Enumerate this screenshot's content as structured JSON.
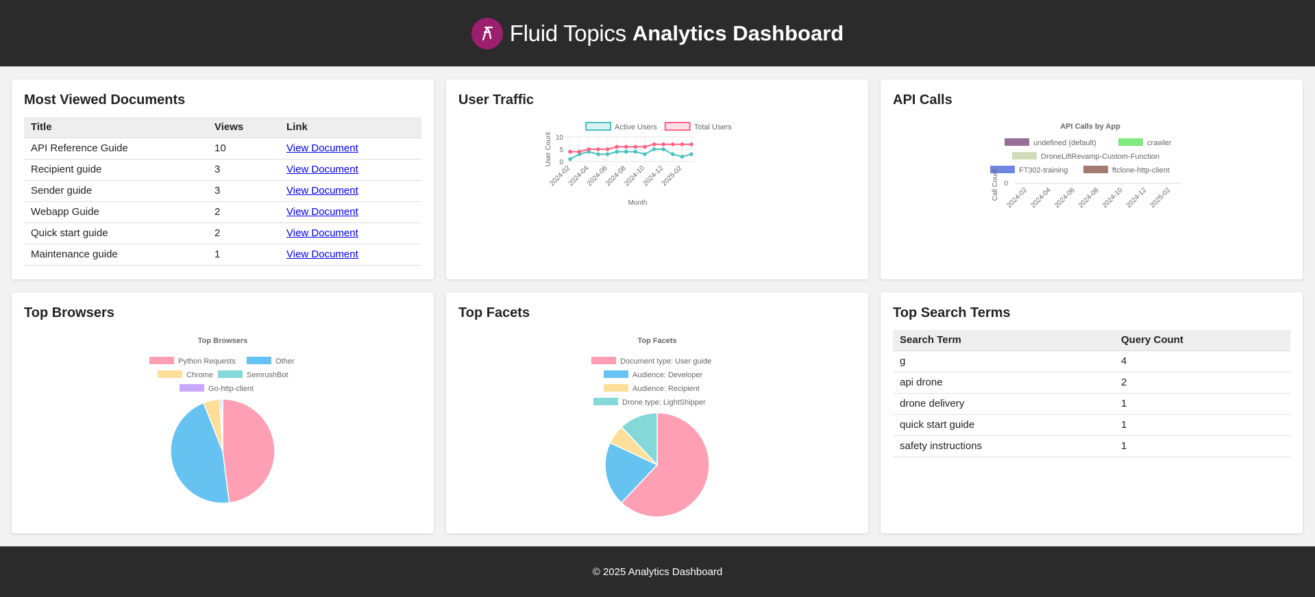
{
  "header": {
    "brand": "Fluid Topics",
    "title": "Analytics Dashboard"
  },
  "most_viewed": {
    "title": "Most Viewed Documents",
    "columns": [
      "Title",
      "Views",
      "Link"
    ],
    "rows": [
      {
        "title": "API Reference Guide",
        "views": "10",
        "link": "View Document"
      },
      {
        "title": "Recipient guide",
        "views": "3",
        "link": "View Document"
      },
      {
        "title": "Sender guide",
        "views": "3",
        "link": "View Document"
      },
      {
        "title": "Webapp Guide",
        "views": "2",
        "link": "View Document"
      },
      {
        "title": "Quick start guide",
        "views": "2",
        "link": "View Document"
      },
      {
        "title": "Maintenance guide",
        "views": "1",
        "link": "View Document"
      }
    ]
  },
  "user_traffic": {
    "title": "User Traffic"
  },
  "api_calls": {
    "title": "API Calls"
  },
  "top_browsers": {
    "title": "Top Browsers"
  },
  "top_facets": {
    "title": "Top Facets"
  },
  "top_search_terms": {
    "title": "Top Search Terms",
    "columns": [
      "Search Term",
      "Query Count"
    ],
    "rows": [
      {
        "term": "g",
        "count": "4"
      },
      {
        "term": "api drone",
        "count": "2"
      },
      {
        "term": "drone delivery",
        "count": "1"
      },
      {
        "term": "quick start guide",
        "count": "1"
      },
      {
        "term": "safety instructions",
        "count": "1"
      }
    ]
  },
  "footer": {
    "text": "© 2025 Analytics Dashboard"
  },
  "chart_data": [
    {
      "id": "user-traffic",
      "type": "line",
      "title": "",
      "xlabel": "Month",
      "ylabel": "User Count",
      "x": [
        "2024-02",
        "2024-03",
        "2024-04",
        "2024-05",
        "2024-06",
        "2024-07",
        "2024-08",
        "2024-09",
        "2024-10",
        "2024-11",
        "2024-12",
        "2025-01",
        "2025-02",
        "2025-03"
      ],
      "x_tick_labels": [
        "2024-02",
        "2024-04",
        "2024-06",
        "2024-08",
        "2024-10",
        "2024-12",
        "2025-02"
      ],
      "y_ticks": [
        0,
        5,
        10
      ],
      "ylim": [
        0,
        10
      ],
      "legend": "top",
      "series": [
        {
          "name": "Active Users",
          "color": "#4bc0c0",
          "values": [
            1,
            3,
            4,
            3,
            3,
            4,
            4,
            4,
            3,
            5,
            5,
            3,
            2,
            3
          ]
        },
        {
          "name": "Total Users",
          "color": "#ff6384",
          "values": [
            4,
            4,
            5,
            5,
            5,
            6,
            6,
            6,
            6,
            7,
            7,
            7,
            7,
            7
          ]
        }
      ]
    },
    {
      "id": "api-calls",
      "type": "bar",
      "title": "API Calls by App",
      "xlabel": "",
      "ylabel": "Call Count",
      "x_tick_labels": [
        "2024-02",
        "2024-04",
        "2024-06",
        "2024-08",
        "2024-10",
        "2024-12",
        "2025-02"
      ],
      "y_ticks": [
        0
      ],
      "legend": "top",
      "series": [
        {
          "name": "undefined (default)",
          "color": "#9a6f97"
        },
        {
          "name": "crawler",
          "color": "#7fe87f"
        },
        {
          "name": "DroneLiftRevamp-Custom-Function",
          "color": "#d2dcbb"
        },
        {
          "name": "FT302-training",
          "color": "#6f86e0"
        },
        {
          "name": "ftclone-http-client",
          "color": "#a37b73"
        }
      ]
    },
    {
      "id": "top-browsers",
      "type": "pie",
      "title": "Top Browsers",
      "legend": "top",
      "series": [
        {
          "name": "Top Browsers",
          "labels": [
            "Python Requests",
            "Other",
            "Chrome",
            "SemrushBot",
            "Go-http-client"
          ],
          "colors": [
            "#ff9fb3",
            "#66c2f0",
            "#ffde99",
            "#84d8d8",
            "#c7a8ff"
          ],
          "values": [
            48,
            46,
            5,
            0.6,
            0.4
          ]
        }
      ]
    },
    {
      "id": "top-facets",
      "type": "pie",
      "title": "Top Facets",
      "legend": "top",
      "series": [
        {
          "name": "Top Facets",
          "labels": [
            "Document type: User guide",
            "Audience: Developer",
            "Audience: Recipient",
            "Drone type: LightShipper"
          ],
          "colors": [
            "#ff9fb3",
            "#66c2f0",
            "#ffde99",
            "#84d8d8"
          ],
          "values": [
            62,
            20,
            6,
            12
          ]
        }
      ]
    }
  ]
}
